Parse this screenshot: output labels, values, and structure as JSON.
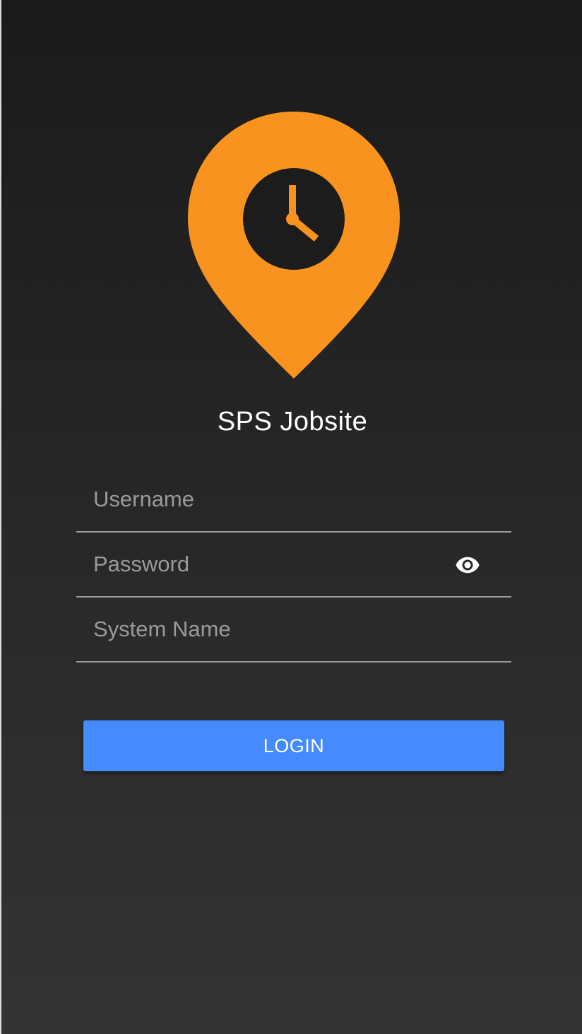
{
  "app": {
    "title": "SPS Jobsite",
    "logo_icon": "location-pin-clock-icon"
  },
  "colors": {
    "brand_orange": "#F7931E",
    "button_blue": "#458AFF",
    "background_top": "#1A1A1A",
    "background_bottom": "#343434"
  },
  "form": {
    "username": {
      "placeholder": "Username",
      "value": ""
    },
    "password": {
      "placeholder": "Password",
      "value": "",
      "toggle_icon": "eye-icon"
    },
    "system_name": {
      "placeholder": "System Name",
      "value": ""
    },
    "login_label": "LOGIN"
  }
}
